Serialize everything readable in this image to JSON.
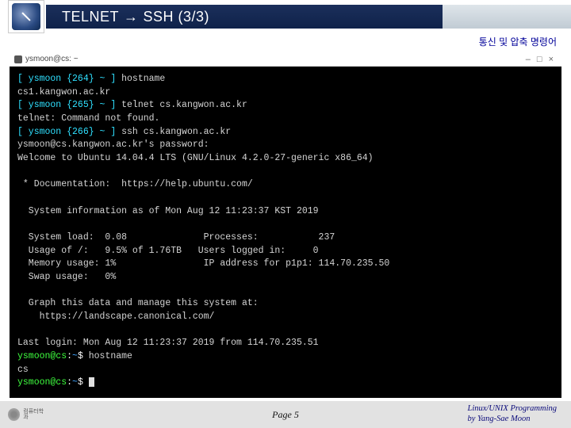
{
  "header": {
    "title_pre": "TELNET",
    "title_arrow": "→",
    "title_post": "SSH (3/3)",
    "subtitle": "통신 및 압축 명령어"
  },
  "term_window": {
    "tab_label": "ysmoon@cs: ~",
    "win_minimize": "–",
    "win_maximize": "□",
    "win_close": "×"
  },
  "terminal": {
    "p1_open": "[ ysmoon {264} ~ ] ",
    "p1_cmd": "hostname",
    "line_host1": "cs1.kangwon.ac.kr",
    "p2_open": "[ ysmoon {265} ~ ] ",
    "p2_cmd": "telnet cs.kangwon.ac.kr",
    "line_telnet_err": "telnet: Command not found.",
    "p3_open": "[ ysmoon {266} ~ ] ",
    "p3_cmd": "ssh cs.kangwon.ac.kr",
    "line_pwd": "ysmoon@cs.kangwon.ac.kr's password:",
    "line_welcome": "Welcome to Ubuntu 14.04.4 LTS (GNU/Linux 4.2.0-27-generic x86_64)",
    "line_doc": " * Documentation:  https://help.ubuntu.com/",
    "line_sysinfo_hdr": "  System information as of Mon Aug 12 11:23:37 KST 2019",
    "sys_l1": "  System load:  0.08              Processes:           237",
    "sys_l2": "  Usage of /:   9.5% of 1.76TB   Users logged in:     0",
    "sys_l3": "  Memory usage: 1%                IP address for p1p1: 114.70.235.50",
    "sys_l4": "  Swap usage:   0%",
    "line_graph1": "  Graph this data and manage this system at:",
    "line_graph2": "    https://landscape.canonical.com/",
    "line_lastlogin": "Last login: Mon Aug 12 11:23:37 2019 from 114.70.235.51",
    "ps_user": "ysmoon@cs",
    "ps_colon": ":",
    "ps_path": "~",
    "ps_dollar": "$ ",
    "cmd_hostname2": "hostname",
    "line_host2": "cs"
  },
  "footer": {
    "logo_text": "컴퓨터학과",
    "page": "Page 5",
    "credit1": "Linux/UNIX Programming",
    "credit2": "by Yang-Sae Moon"
  }
}
